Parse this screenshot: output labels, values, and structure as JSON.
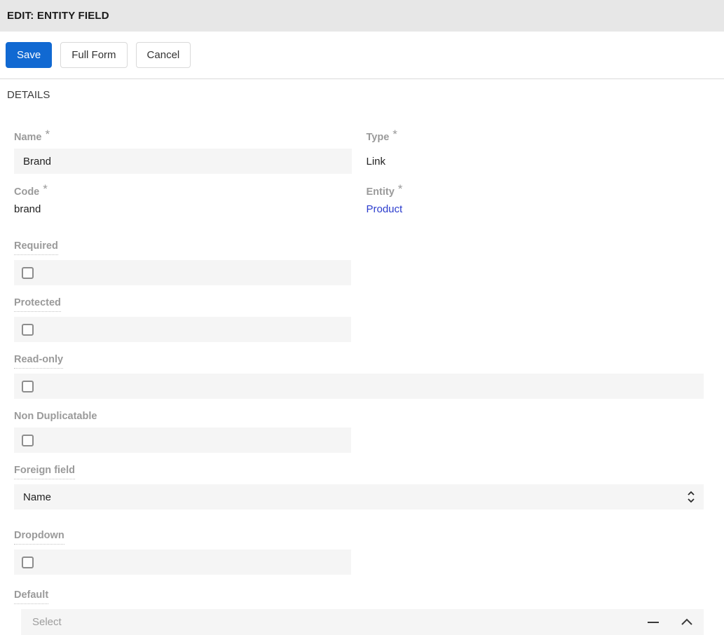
{
  "header": {
    "title": "EDIT: ENTITY FIELD"
  },
  "toolbar": {
    "save_label": "Save",
    "full_form_label": "Full Form",
    "cancel_label": "Cancel"
  },
  "panel": {
    "title": "DETAILS"
  },
  "required_marker": "*",
  "fields": {
    "name": {
      "label": "Name",
      "value": "Brand"
    },
    "type": {
      "label": "Type",
      "value": "Link"
    },
    "code": {
      "label": "Code",
      "value": "brand"
    },
    "entity": {
      "label": "Entity",
      "value": "Product"
    },
    "required": {
      "label": "Required",
      "checked": false
    },
    "protected": {
      "label": "Protected",
      "checked": false
    },
    "read_only": {
      "label": "Read-only",
      "checked": false
    },
    "non_duplicatable": {
      "label": "Non Duplicatable",
      "checked": false
    },
    "foreign_field": {
      "label": "Foreign field",
      "value": "Name"
    },
    "dropdown": {
      "label": "Dropdown",
      "checked": false
    },
    "default": {
      "label": "Default",
      "placeholder": "Select"
    }
  },
  "icons": {
    "foreign_field_select": "up-down-chevron",
    "default_remove": "minus",
    "default_collapse": "chevron-up"
  },
  "colors": {
    "accent": "#1169d2",
    "link": "#2b3ccd",
    "header_bg": "#e7e7e7",
    "field_bg": "#f5f5f5"
  }
}
